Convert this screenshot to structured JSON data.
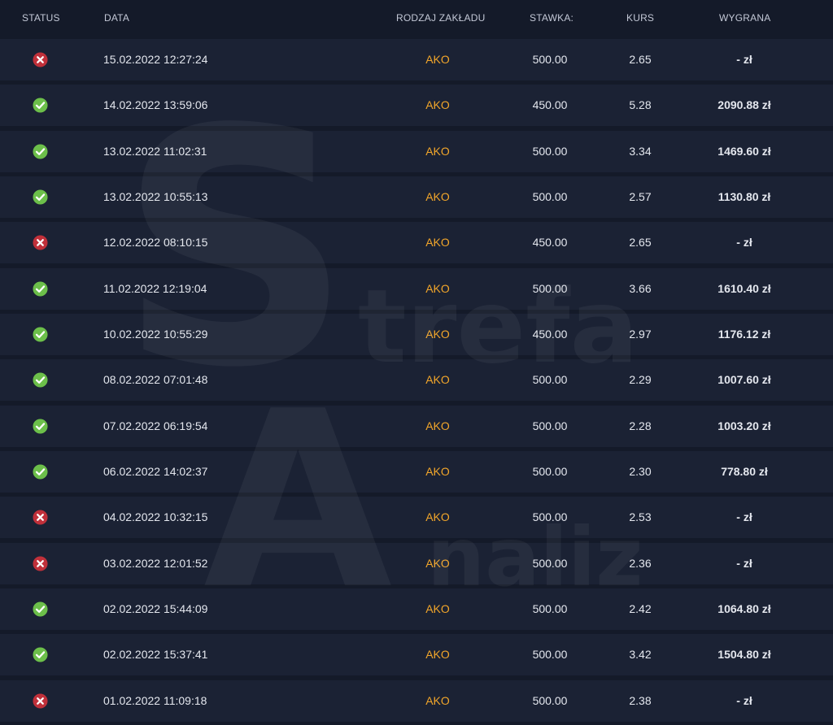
{
  "header": {
    "status": "STATUS",
    "date": "DATA",
    "type": "RODZAJ ZAKŁADU",
    "stake": "STAWKA:",
    "odds": "KURS",
    "win": "WYGRANA"
  },
  "watermark": {
    "letter_s": "S",
    "word_1": "trefa",
    "letter_a": "A",
    "word_2": "naliz"
  },
  "colors": {
    "win_icon": "#6cbf4a",
    "loss_icon": "#c0303a",
    "bet_type": "#f2a62a"
  },
  "rows": [
    {
      "status": "lost",
      "icon": "x-circle-icon",
      "date": "15.02.2022 12:27:24",
      "type": "AKO",
      "stake": "500.00",
      "odds": "2.65",
      "win": "- zł"
    },
    {
      "status": "won",
      "icon": "check-circle-icon",
      "date": "14.02.2022 13:59:06",
      "type": "AKO",
      "stake": "450.00",
      "odds": "5.28",
      "win": "2090.88 zł"
    },
    {
      "status": "won",
      "icon": "check-circle-icon",
      "date": "13.02.2022 11:02:31",
      "type": "AKO",
      "stake": "500.00",
      "odds": "3.34",
      "win": "1469.60 zł"
    },
    {
      "status": "won",
      "icon": "check-circle-icon",
      "date": "13.02.2022 10:55:13",
      "type": "AKO",
      "stake": "500.00",
      "odds": "2.57",
      "win": "1130.80 zł"
    },
    {
      "status": "lost",
      "icon": "x-circle-icon",
      "date": "12.02.2022 08:10:15",
      "type": "AKO",
      "stake": "450.00",
      "odds": "2.65",
      "win": "- zł"
    },
    {
      "status": "won",
      "icon": "check-circle-icon",
      "date": "11.02.2022 12:19:04",
      "type": "AKO",
      "stake": "500.00",
      "odds": "3.66",
      "win": "1610.40 zł"
    },
    {
      "status": "won",
      "icon": "check-circle-icon",
      "date": "10.02.2022 10:55:29",
      "type": "AKO",
      "stake": "450.00",
      "odds": "2.97",
      "win": "1176.12 zł"
    },
    {
      "status": "won",
      "icon": "check-circle-icon",
      "date": "08.02.2022 07:01:48",
      "type": "AKO",
      "stake": "500.00",
      "odds": "2.29",
      "win": "1007.60 zł"
    },
    {
      "status": "won",
      "icon": "check-circle-icon",
      "date": "07.02.2022 06:19:54",
      "type": "AKO",
      "stake": "500.00",
      "odds": "2.28",
      "win": "1003.20 zł"
    },
    {
      "status": "won",
      "icon": "check-circle-icon",
      "date": "06.02.2022 14:02:37",
      "type": "AKO",
      "stake": "500.00",
      "odds": "2.30",
      "win": "778.80 zł"
    },
    {
      "status": "lost",
      "icon": "x-circle-icon",
      "date": "04.02.2022 10:32:15",
      "type": "AKO",
      "stake": "500.00",
      "odds": "2.53",
      "win": "- zł"
    },
    {
      "status": "lost",
      "icon": "x-circle-icon",
      "date": "03.02.2022 12:01:52",
      "type": "AKO",
      "stake": "500.00",
      "odds": "2.36",
      "win": "- zł"
    },
    {
      "status": "won",
      "icon": "check-circle-icon",
      "date": "02.02.2022 15:44:09",
      "type": "AKO",
      "stake": "500.00",
      "odds": "2.42",
      "win": "1064.80 zł"
    },
    {
      "status": "won",
      "icon": "check-circle-icon",
      "date": "02.02.2022 15:37:41",
      "type": "AKO",
      "stake": "500.00",
      "odds": "3.42",
      "win": "1504.80 zł"
    },
    {
      "status": "lost",
      "icon": "x-circle-icon",
      "date": "01.02.2022 11:09:18",
      "type": "AKO",
      "stake": "500.00",
      "odds": "2.38",
      "win": "- zł"
    }
  ]
}
